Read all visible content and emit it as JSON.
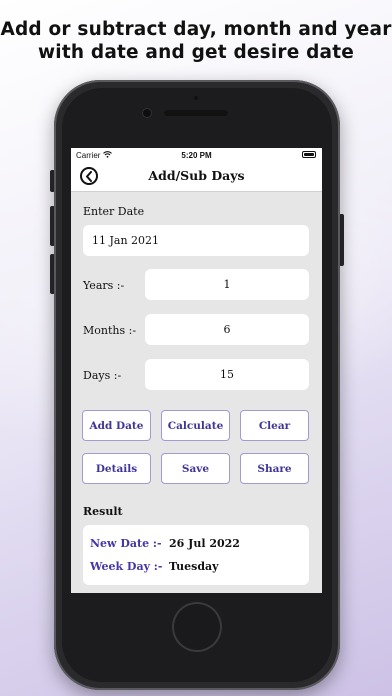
{
  "promo": {
    "line1": "Add or subtract day, month and year",
    "line2": "with date and get desire date"
  },
  "status_bar": {
    "carrier": "Carrier",
    "time": "5:20 PM"
  },
  "nav": {
    "title": "Add/Sub Days",
    "back_icon": "back-arrow-circle-icon"
  },
  "form": {
    "enter_date_label": "Enter Date",
    "date_value": "11 Jan 2021",
    "years_label": "Years :-",
    "years_value": "1",
    "months_label": "Months :-",
    "months_value": "6",
    "days_label": "Days :-",
    "days_value": "15"
  },
  "buttons": {
    "add_date": "Add Date",
    "calculate": "Calculate",
    "clear": "Clear",
    "details": "Details",
    "save": "Save",
    "share": "Share"
  },
  "result": {
    "title": "Result",
    "new_date_label": "New Date :-",
    "new_date_value": "26 Jul 2022",
    "week_day_label": "Week Day :-",
    "week_day_value": "Tuesday"
  },
  "colors": {
    "accent": "#3f3596",
    "button_border": "#a39ad0",
    "screen_bg": "#e6e6e6"
  }
}
